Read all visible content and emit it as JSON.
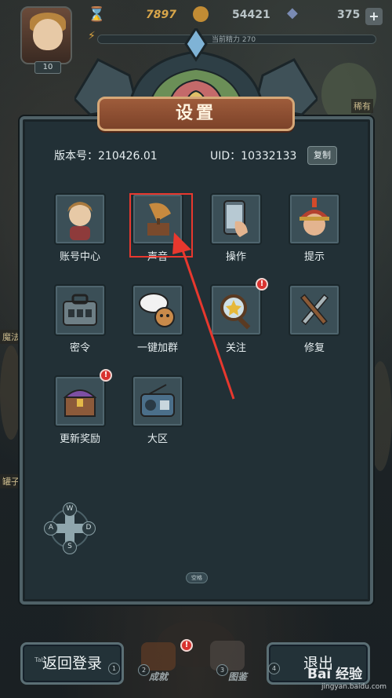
{
  "hud": {
    "level": "10",
    "gold": "7897",
    "coins": "54421",
    "gems": "375",
    "stamina_label": "当前精力",
    "stamina_value": "270",
    "add_label": "+"
  },
  "side_labels": {
    "right_top": "稀有",
    "left_mid": "魔法",
    "left_low": "罐子"
  },
  "dialog": {
    "title": "设置",
    "version_label": "版本号：",
    "version": "210426.01",
    "uid_label": "UID：",
    "uid": "10332133",
    "copy_label": "复制",
    "items": [
      {
        "label": "账号中心",
        "icon": "account-icon",
        "badge": ""
      },
      {
        "label": "声音",
        "icon": "gramophone-icon",
        "badge": ""
      },
      {
        "label": "操作",
        "icon": "phone-touch-icon",
        "badge": ""
      },
      {
        "label": "提示",
        "icon": "helmet-guard-icon",
        "badge": ""
      },
      {
        "label": "密令",
        "icon": "briefcase-icon",
        "badge": ""
      },
      {
        "label": "一键加群",
        "icon": "chat-group-icon",
        "badge": ""
      },
      {
        "label": "关注",
        "icon": "magnifier-star-icon",
        "badge": "!"
      },
      {
        "label": "修复",
        "icon": "wrench-screwdriver-icon",
        "badge": ""
      },
      {
        "label": "更新奖励",
        "icon": "treasure-chest-icon",
        "badge": "!"
      },
      {
        "label": "大区",
        "icon": "radio-icon",
        "badge": ""
      }
    ],
    "dpad": {
      "up": "W",
      "left": "A",
      "right": "D",
      "down": "S"
    },
    "space_key": "空格"
  },
  "bottom": {
    "back_login": "返回登录",
    "tab_key": "Tab",
    "exit": "退出",
    "slot_numbers": [
      "1",
      "2",
      "3",
      "4"
    ],
    "slot_labels": [
      "成就",
      "图鉴"
    ]
  },
  "watermark": {
    "brand": "Bai 经验",
    "url": "jingyan.baidu.com"
  },
  "colors": {
    "title_plate": "#8a4b2f",
    "highlight": "#e8382e",
    "panel": "#223036"
  }
}
